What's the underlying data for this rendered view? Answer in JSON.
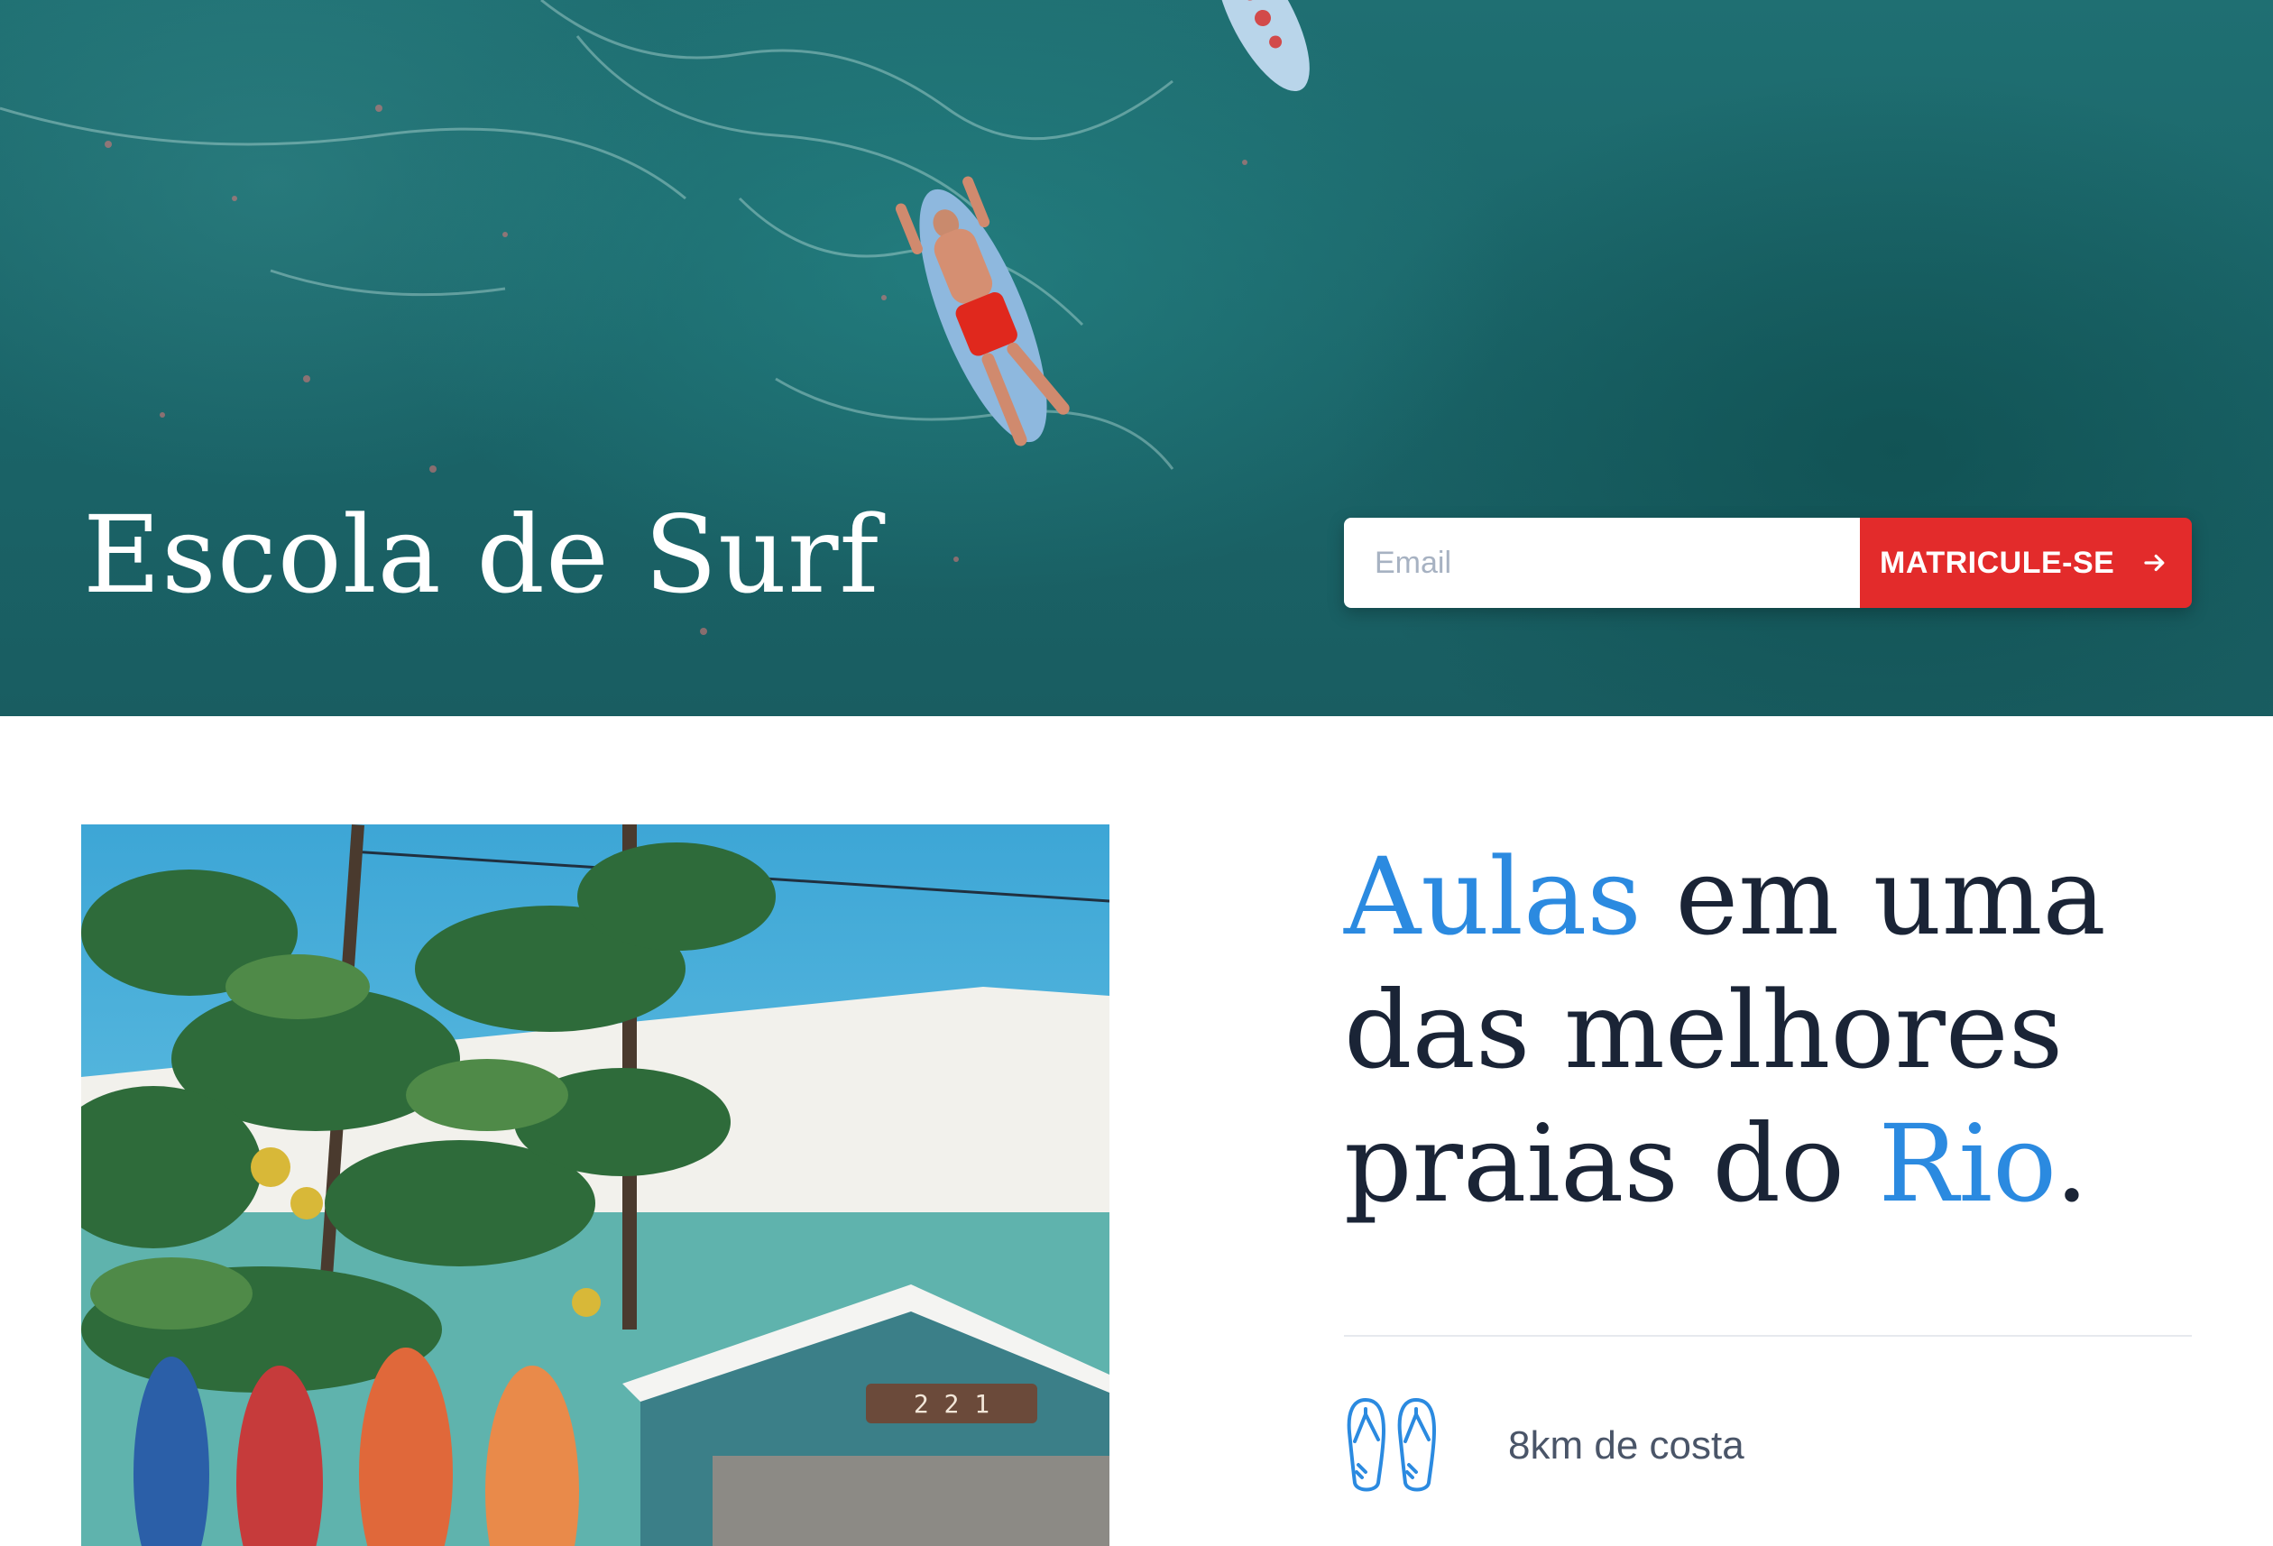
{
  "hero": {
    "title": "Escola de Surf",
    "email_placeholder": "Email",
    "signup_label": "MATRICULE-SE",
    "signup_icon": "arrow-right-icon"
  },
  "intro": {
    "headline_accent1": "Aulas",
    "headline_mid": " em uma das melhores praias do ",
    "headline_accent2": "Rio",
    "headline_end": "."
  },
  "photo": {
    "house_number": "2 2 1"
  },
  "features": [
    {
      "icon": "flip-flops-icon",
      "label": "8km de costa"
    }
  ],
  "colors": {
    "accent": "#2b8ae0",
    "button": "#e32b2b",
    "heading": "#1a2436",
    "ocean": "#1f6f72"
  }
}
